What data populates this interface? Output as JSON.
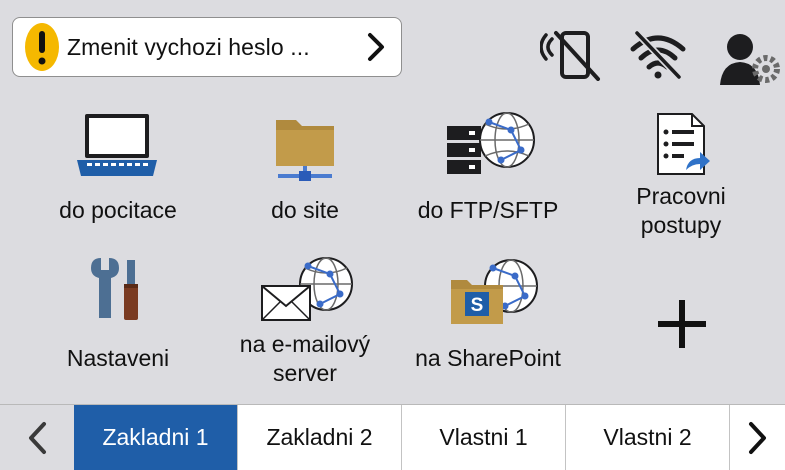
{
  "notification": {
    "text": "Zmenit vychozi heslo ...",
    "icon": "warning-icon",
    "accent": "#f5b800"
  },
  "status_icons": [
    "nfc-disabled-icon",
    "wifi-disabled-icon",
    "user-settings-icon"
  ],
  "shortcuts": [
    {
      "label": "do pocitace",
      "icon": "laptop-icon"
    },
    {
      "label": "do site",
      "icon": "network-folder-icon"
    },
    {
      "label": "do FTP/SFTP",
      "icon": "ftp-server-icon"
    },
    {
      "label": "Pracovni\npostupy",
      "icon": "workflow-document-icon"
    },
    {
      "label": "Nastaveni",
      "icon": "tools-icon"
    },
    {
      "label": "na e-mailový\nserver",
      "icon": "email-server-icon"
    },
    {
      "label": "na SharePoint",
      "icon": "sharepoint-icon"
    },
    {
      "label": "",
      "icon": "add-icon"
    }
  ],
  "tabs": [
    {
      "label": "Zakladni 1",
      "active": true
    },
    {
      "label": "Zakladni 2",
      "active": false
    },
    {
      "label": "Vlastni 1",
      "active": false
    },
    {
      "label": "Vlastni 2",
      "active": false
    }
  ],
  "colors": {
    "background": "#dcdce0",
    "tab_active": "#1f5ea8",
    "icon_dark": "#1d1d1f",
    "folder": "#b08a3e",
    "laptop": "#1f5ea8",
    "globe": "#3a6bc8"
  }
}
